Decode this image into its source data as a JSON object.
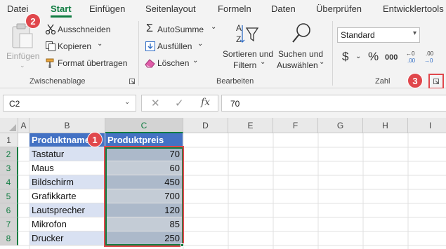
{
  "menu": {
    "tabs": [
      "Datei",
      "Start",
      "Einfügen",
      "Seitenlayout",
      "Formeln",
      "Daten",
      "Überprüfen",
      "Entwicklertools"
    ],
    "active": "Start"
  },
  "ribbon": {
    "clipboard": {
      "paste_label": "Einfügen",
      "cut_label": "Ausschneiden",
      "copy_label": "Kopieren",
      "format_painter_label": "Format übertragen",
      "group_label": "Zwischenablage"
    },
    "editing": {
      "autosum_label": "AutoSumme",
      "fill_label": "Ausfüllen",
      "clear_label": "Löschen",
      "sort_label_line1": "Sortieren und",
      "sort_label_line2": "Filtern",
      "find_label_line1": "Suchen und",
      "find_label_line2": "Auswählen",
      "group_label": "Bearbeiten"
    },
    "number": {
      "format_value": "Standard",
      "currency_symbol": "$",
      "percent_symbol": "%",
      "comma_symbol": "000",
      "group_label": "Zahl"
    }
  },
  "formula_bar": {
    "name_box": "C2",
    "fx_label": "fx",
    "value": "70"
  },
  "grid": {
    "columns": [
      "A",
      "B",
      "C",
      "D",
      "E",
      "F",
      "G",
      "H",
      "I"
    ],
    "rows": [
      "1",
      "2",
      "3",
      "4",
      "5",
      "6",
      "7",
      "8"
    ],
    "header": {
      "name": "Produktname",
      "price": "Produktpreis"
    },
    "products": [
      {
        "name": "Tastatur",
        "price": "70"
      },
      {
        "name": "Maus",
        "price": "60"
      },
      {
        "name": "Bildschirm",
        "price": "450"
      },
      {
        "name": "Grafikkarte",
        "price": "700"
      },
      {
        "name": "Lautsprecher",
        "price": "120"
      },
      {
        "name": "Mikrofon",
        "price": "85"
      },
      {
        "name": "Drucker",
        "price": "250"
      }
    ]
  },
  "callouts": [
    "1",
    "2",
    "3"
  ],
  "colors": {
    "accent": "#107c41",
    "table_header": "#4472c4",
    "callout": "#e0474c"
  }
}
